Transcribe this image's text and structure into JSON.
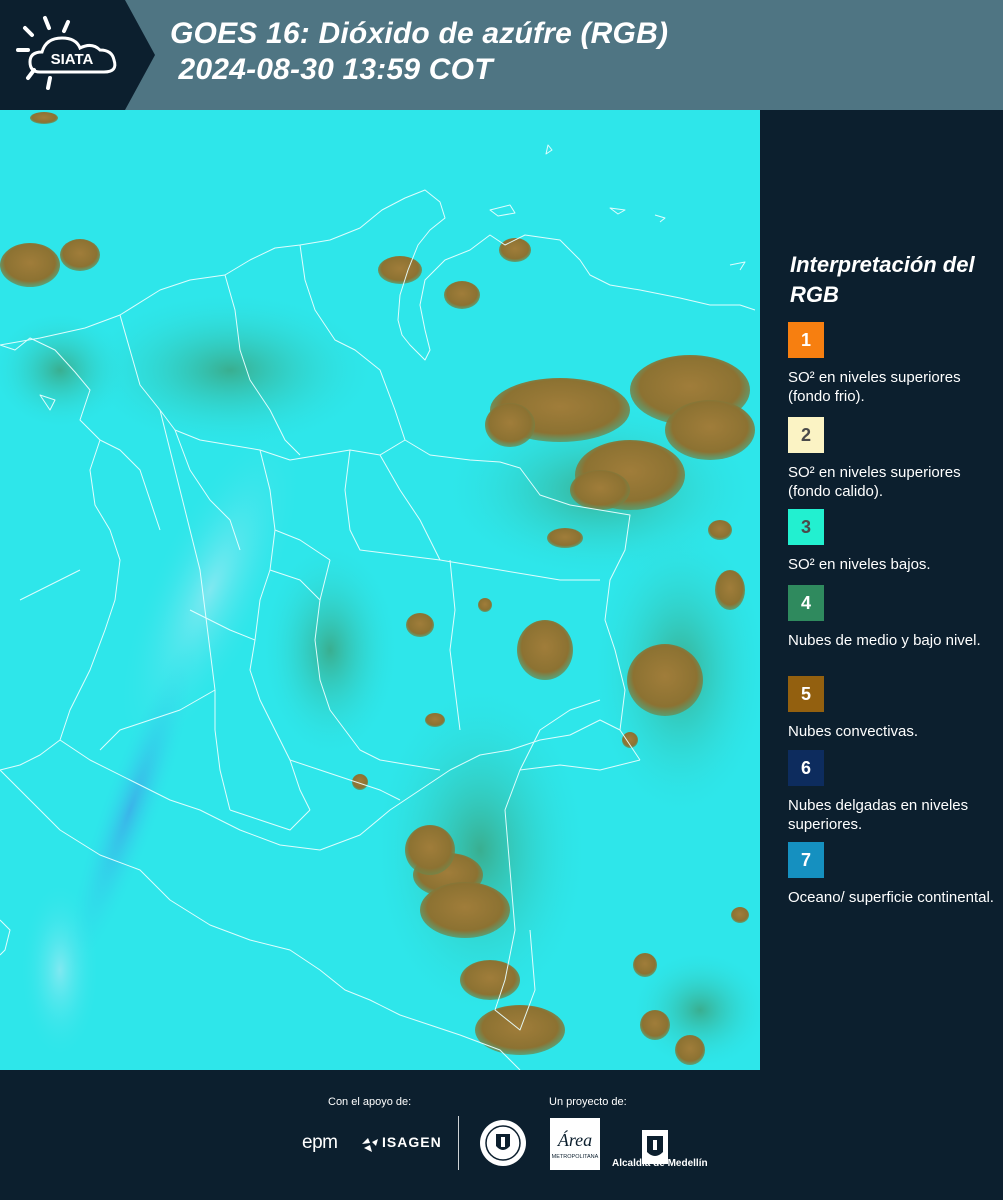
{
  "header": {
    "logo_text": "SIATA",
    "title_line1": "GOES 16: Dióxido de azúfre (RGB)",
    "title_line2": " 2024-08-30 13:59 COT"
  },
  "map": {
    "background_color": "#2ee6ea",
    "cloud_color": "#9a7a35",
    "border_color": "#e8ffff"
  },
  "legend": {
    "title": "Interpretación del RGB",
    "items": [
      {
        "number": "1",
        "color": "#f77f10",
        "label": "SO² en niveles superiores (fondo frio)."
      },
      {
        "number": "2",
        "color": "#fbf3c4",
        "label": "SO² en niveles superiores (fondo calido)."
      },
      {
        "number": "3",
        "color": "#22f0d0",
        "label": "SO² en niveles bajos."
      },
      {
        "number": "4",
        "color": "#2f8a5e",
        "label": "Nubes de medio y bajo nivel."
      },
      {
        "number": "5",
        "color": "#93600f",
        "label": "Nubes convectivas."
      },
      {
        "number": "6",
        "color": "#0d2c5e",
        "label": "Nubes delgadas en niveles superiores."
      },
      {
        "number": "7",
        "color": "#1590c0",
        "label": "Oceano/ superficie continental."
      }
    ]
  },
  "footer": {
    "support_label": "Con el apoyo de:",
    "project_label": "Un proyecto de:",
    "sponsor_epm": "epm",
    "sponsor_isagen": "ISAGEN",
    "area_logo_text": "Área",
    "area_logo_sub": "METROPOLITANA",
    "alcaldia_label": "Alcaldía de Medellín"
  }
}
